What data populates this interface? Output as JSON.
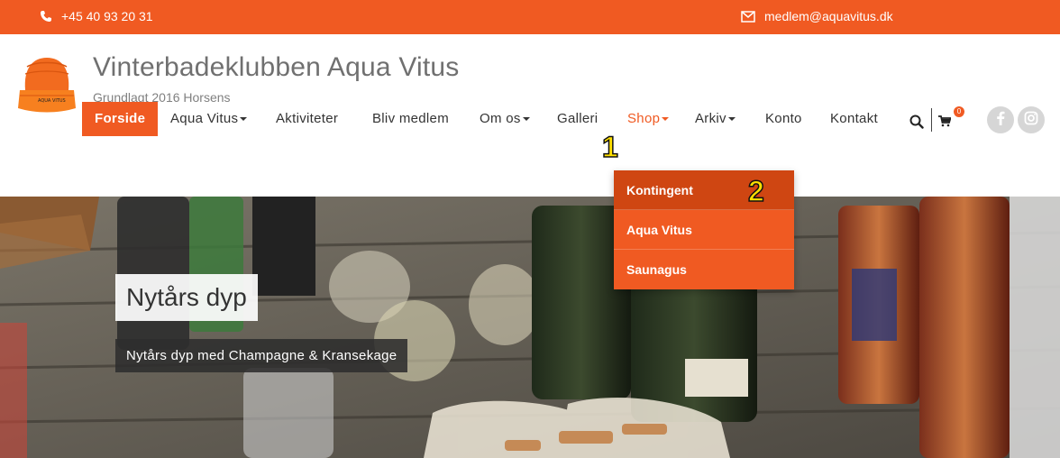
{
  "topbar": {
    "phone_icon": "phone-icon",
    "phone": "+45 40 93 20 31",
    "email_icon": "envelope-icon",
    "email": "medlem@aquavitus.dk",
    "color": "#f05a22"
  },
  "header": {
    "logo_icon": "orange-beanie-logo",
    "site_title": "Vinterbadeklubben Aqua Vitus",
    "tagline": "Grundlagt 2016 Horsens"
  },
  "nav": {
    "items": [
      {
        "label": "Forside"
      },
      {
        "label": "Aqua Vitus"
      },
      {
        "label": "Aktiviteter"
      },
      {
        "label": "Bliv medlem"
      },
      {
        "label": "Om os"
      },
      {
        "label": "Galleri"
      },
      {
        "label": "Shop"
      },
      {
        "label": "Arkiv"
      },
      {
        "label": "Konto"
      },
      {
        "label": "Kontakt"
      }
    ],
    "cart_count": "0",
    "icons": [
      "search-icon",
      "cart-icon",
      "facebook-icon",
      "instagram-icon"
    ]
  },
  "dropdown": {
    "items": [
      {
        "label": "Kontingent"
      },
      {
        "label": "Aqua Vitus"
      },
      {
        "label": "Saunagus"
      }
    ]
  },
  "hero": {
    "title": "Nytårs dyp",
    "subtitle": "Nytårs dyp med Champagne & Kransekage"
  },
  "markers": {
    "first": "1",
    "second": "2"
  },
  "colors": {
    "accent": "#f05a22",
    "accent_dark": "#cf4612"
  }
}
